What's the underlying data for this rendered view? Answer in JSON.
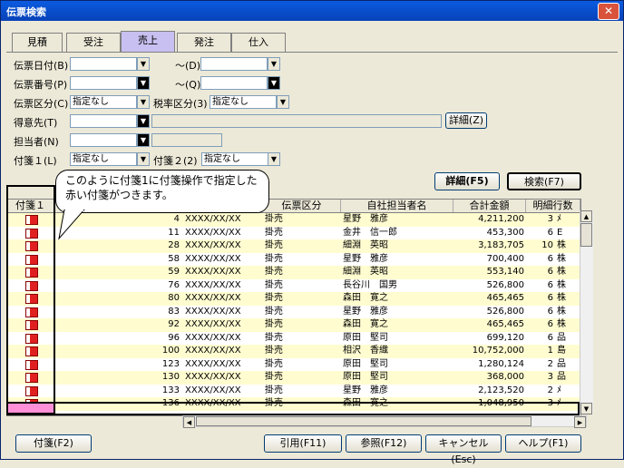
{
  "window": {
    "title": "伝票検索",
    "close_glyph": "✕"
  },
  "tabs": [
    {
      "label": "見積"
    },
    {
      "label": "受注"
    },
    {
      "label": "売上"
    },
    {
      "label": "発注"
    },
    {
      "label": "仕入"
    }
  ],
  "filters": {
    "date_label": "伝票日付(B)",
    "date_to_label": "～(D)",
    "number_label": "伝票番号(P)",
    "number_to_label": "～(Q)",
    "kind_label": "伝票区分(C)",
    "kind_value": "指定なし",
    "tax_label": "税率区分(3)",
    "tax_value": "指定なし",
    "customer_label": "得意先(T)",
    "detail_button": "詳細(Z)",
    "staff_label": "担当者(N)",
    "tag1_label": "付箋１(L)",
    "tag1_value": "指定なし",
    "tag2_label": "付箋２(2)",
    "tag2_value": "指定なし"
  },
  "buttons": {
    "detail_f5": "詳細(F5)",
    "search_f7": "検索(F7)",
    "tag_f2": "付箋(F2)",
    "quote_f11": "引用(F11)",
    "ref_f12": "参照(F12)",
    "cancel_esc": "キャンセル(Esc)",
    "help_f1": "ヘルプ(F1)"
  },
  "callout": "このように付箋1に付箋操作で指定した赤い付箋がつきます。",
  "grid": {
    "headers": [
      "付箋１",
      "伝票区分",
      "自社担当者名",
      "合計金額",
      "明細行数"
    ],
    "rows": [
      {
        "no": "4",
        "date": "XXXX/XX/XX",
        "kind": "掛売",
        "staff": "星野　雅彦",
        "amount": "4,211,200",
        "lines": "3",
        "extra": "ﾒ"
      },
      {
        "no": "11",
        "date": "XXXX/XX/XX",
        "kind": "掛売",
        "staff": "金井　信一郎",
        "amount": "453,300",
        "lines": "6",
        "extra": "E"
      },
      {
        "no": "28",
        "date": "XXXX/XX/XX",
        "kind": "掛売",
        "staff": "細淵　英昭",
        "amount": "3,183,705",
        "lines": "10",
        "extra": "株"
      },
      {
        "no": "58",
        "date": "XXXX/XX/XX",
        "kind": "掛売",
        "staff": "星野　雅彦",
        "amount": "700,400",
        "lines": "6",
        "extra": "株"
      },
      {
        "no": "59",
        "date": "XXXX/XX/XX",
        "kind": "掛売",
        "staff": "細淵　英昭",
        "amount": "553,140",
        "lines": "6",
        "extra": "株"
      },
      {
        "no": "76",
        "date": "XXXX/XX/XX",
        "kind": "掛売",
        "staff": "長谷川　国男",
        "amount": "526,800",
        "lines": "6",
        "extra": "株"
      },
      {
        "no": "80",
        "date": "XXXX/XX/XX",
        "kind": "掛売",
        "staff": "森田　寛之",
        "amount": "465,465",
        "lines": "6",
        "extra": "株"
      },
      {
        "no": "83",
        "date": "XXXX/XX/XX",
        "kind": "掛売",
        "staff": "星野　雅彦",
        "amount": "526,800",
        "lines": "6",
        "extra": "株"
      },
      {
        "no": "92",
        "date": "XXXX/XX/XX",
        "kind": "掛売",
        "staff": "森田　寛之",
        "amount": "465,465",
        "lines": "6",
        "extra": "株"
      },
      {
        "no": "96",
        "date": "XXXX/XX/XX",
        "kind": "掛売",
        "staff": "原田　堅司",
        "amount": "699,120",
        "lines": "6",
        "extra": "品"
      },
      {
        "no": "100",
        "date": "XXXX/XX/XX",
        "kind": "掛売",
        "staff": "相沢　香織",
        "amount": "10,752,000",
        "lines": "1",
        "extra": "島"
      },
      {
        "no": "123",
        "date": "XXXX/XX/XX",
        "kind": "掛売",
        "staff": "原田　堅司",
        "amount": "1,280,124",
        "lines": "2",
        "extra": "品"
      },
      {
        "no": "130",
        "date": "XXXX/XX/XX",
        "kind": "掛売",
        "staff": "原田　堅司",
        "amount": "368,000",
        "lines": "3",
        "extra": "品"
      },
      {
        "no": "133",
        "date": "XXXX/XX/XX",
        "kind": "掛売",
        "staff": "星野　雅彦",
        "amount": "2,123,520",
        "lines": "2",
        "extra": "ﾒ"
      },
      {
        "no": "136",
        "date": "XXXX/XX/XX",
        "kind": "掛売",
        "staff": "森田　寛之",
        "amount": "1,048,950",
        "lines": "3",
        "extra": "ﾒ"
      }
    ]
  },
  "colors": {
    "selected_tag": "#ff90d8",
    "active_tab": "#c8c0f0",
    "row_alt": "#fffcd0"
  }
}
